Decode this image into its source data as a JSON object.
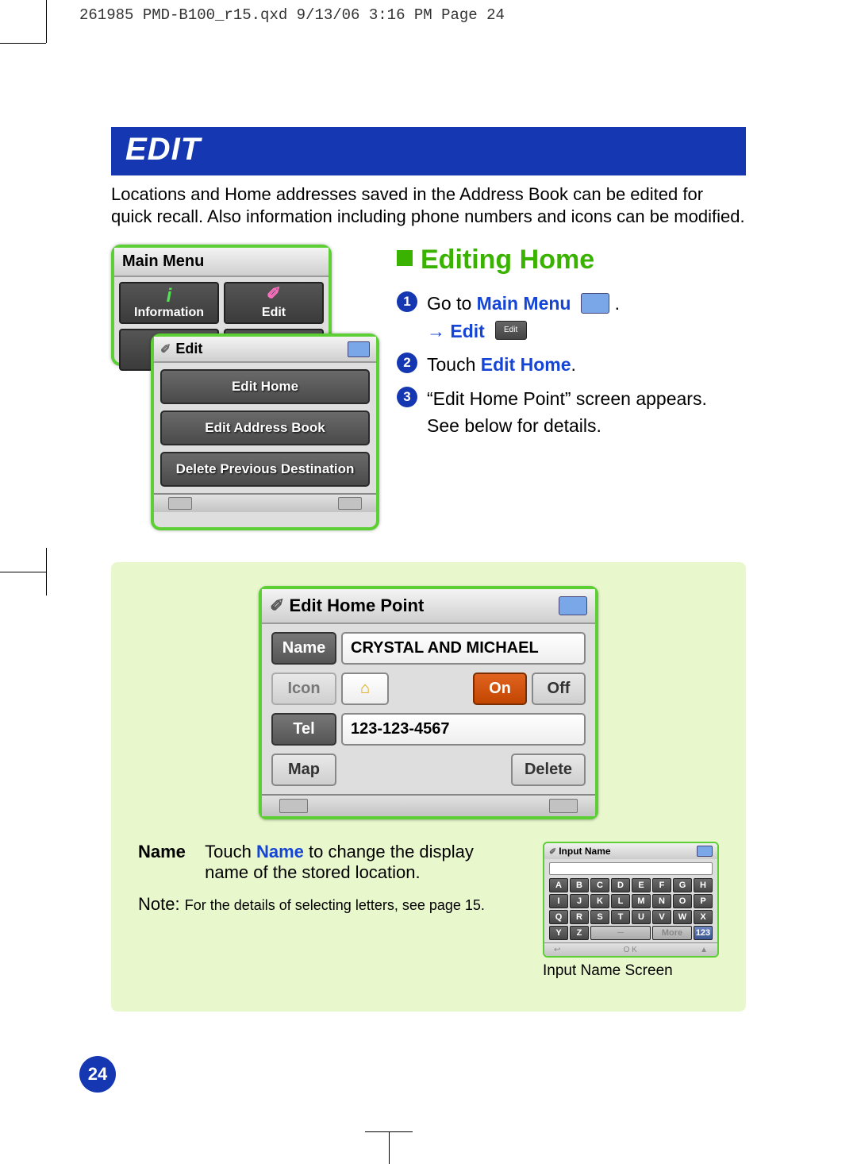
{
  "print_header": "261985 PMD-B100_r15.qxd  9/13/06  3:16 PM  Page 24",
  "section_title": "EDIT",
  "intro": "Locations and Home addresses saved in the Address Book can be edited for quick recall. Also information including phone numbers and icons can be modified.",
  "main_menu": {
    "title": "Main Menu",
    "items": [
      "Information",
      "Edit"
    ]
  },
  "edit_menu": {
    "title": "Edit",
    "items": [
      "Edit Home",
      "Edit Address Book",
      "Delete Previous Destination"
    ]
  },
  "subhead": "Editing Home",
  "steps": {
    "s1_a": "Go to ",
    "s1_main": "Main Menu",
    "s1_arrow": "→ ",
    "s1_edit": "Edit",
    "s2_a": "Touch ",
    "s2_b": "Edit Home",
    "s3_a": "“Edit Home Point” screen appears.",
    "s3_b": "See below for details."
  },
  "ehp": {
    "title": "Edit Home Point",
    "name_label": "Name",
    "name_value": "CRYSTAL AND MICHAEL",
    "icon_label": "Icon",
    "on": "On",
    "off": "Off",
    "tel_label": "Tel",
    "tel_value": "123-123-4567",
    "map": "Map",
    "delete": "Delete"
  },
  "name_block": {
    "label": "Name",
    "touch": "Touch ",
    "name_link": "Name",
    "rest": " to change the display name of the stored location.",
    "note_prefix": "Note: ",
    "note": "For the details of selecting letters, see page 15."
  },
  "keyboard": {
    "title": "Input Name",
    "keys_r1": [
      "A",
      "B",
      "C",
      "D",
      "E",
      "F",
      "G",
      "H"
    ],
    "keys_r2": [
      "I",
      "J",
      "K",
      "L",
      "M",
      "N",
      "O",
      "P"
    ],
    "keys_r3": [
      "Q",
      "R",
      "S",
      "T",
      "U",
      "V",
      "W",
      "X"
    ],
    "y": "Y",
    "z": "Z",
    "more": "More",
    "num": "123",
    "ok": "O K",
    "caption": "Input Name Screen"
  },
  "page_number": "24",
  "mini_edit_label": "Edit"
}
